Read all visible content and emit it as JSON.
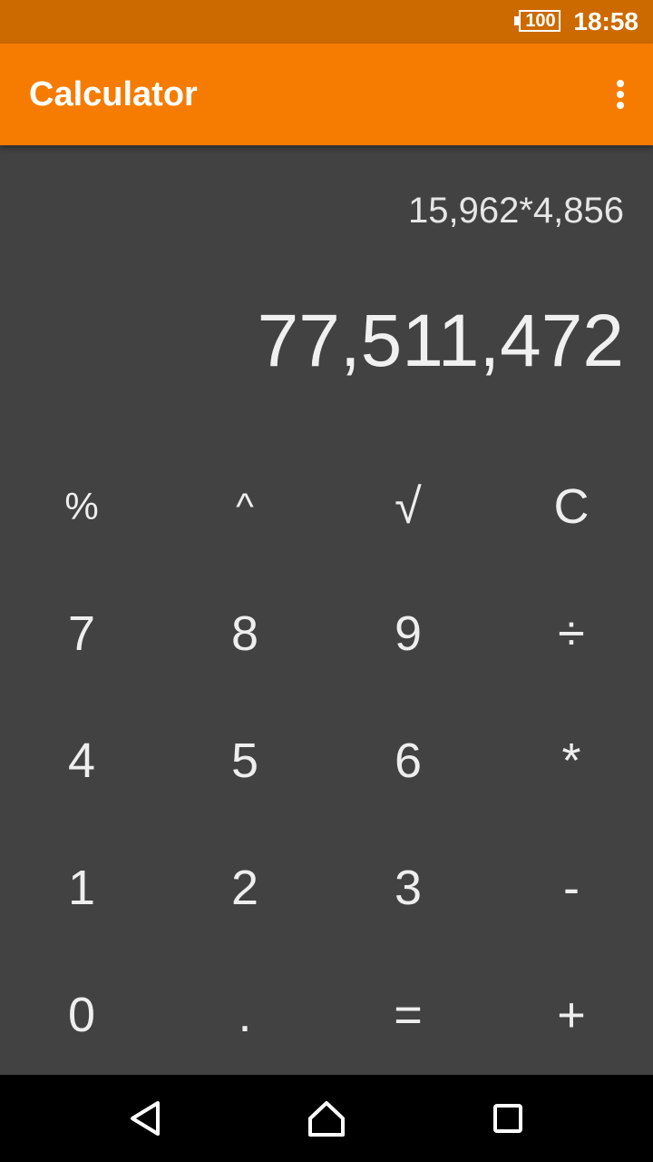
{
  "status_bar": {
    "battery": "100",
    "time": "18:58"
  },
  "app_bar": {
    "title": "Calculator",
    "menu_icon": "more-vert-icon"
  },
  "display": {
    "expression": "15,962*4,856",
    "result": "77,511,472"
  },
  "keypad": {
    "rows": [
      [
        "%",
        "^",
        "√",
        "C"
      ],
      [
        "7",
        "8",
        "9",
        "÷"
      ],
      [
        "4",
        "5",
        "6",
        "*"
      ],
      [
        "1",
        "2",
        "3",
        "-"
      ],
      [
        "0",
        ".",
        "=",
        "+"
      ]
    ]
  },
  "nav_bar": {
    "back_icon": "back-triangle-icon",
    "home_icon": "home-icon",
    "recents_icon": "recents-square-icon"
  },
  "colors": {
    "status_bar": "#cc6a00",
    "app_bar": "#f57c00",
    "background": "#424242",
    "text": "#eeeeee"
  }
}
